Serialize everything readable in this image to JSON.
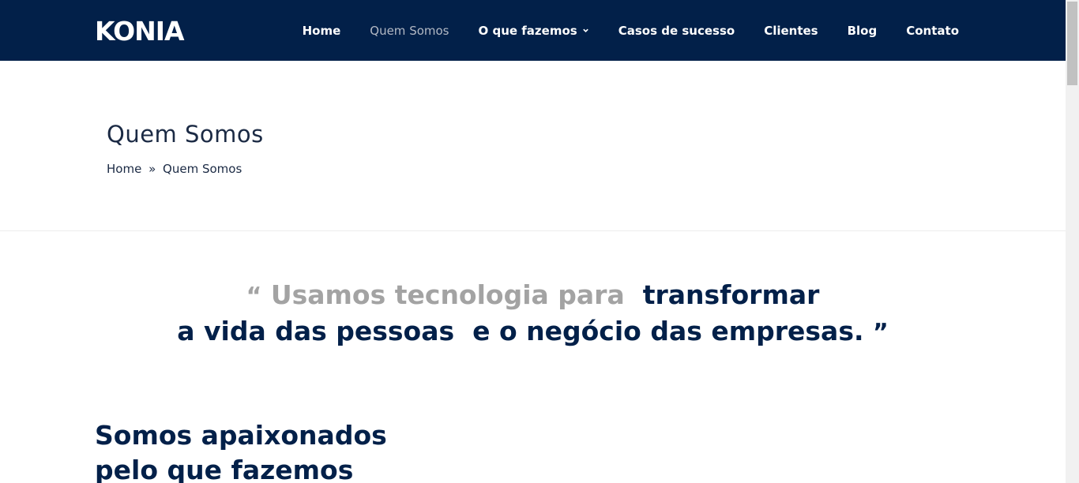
{
  "header": {
    "logo_text": "KONIA",
    "nav": [
      {
        "label": "Home",
        "active": false,
        "has_dropdown": false
      },
      {
        "label": "Quem Somos",
        "active": true,
        "has_dropdown": false
      },
      {
        "label": "O que fazemos",
        "active": false,
        "has_dropdown": true
      },
      {
        "label": "Casos de sucesso",
        "active": false,
        "has_dropdown": false
      },
      {
        "label": "Clientes",
        "active": false,
        "has_dropdown": false
      },
      {
        "label": "Blog",
        "active": false,
        "has_dropdown": false
      },
      {
        "label": "Contato",
        "active": false,
        "has_dropdown": false
      }
    ]
  },
  "title_area": {
    "title": "Quem Somos",
    "breadcrumb": {
      "home": "Home",
      "separator": "»",
      "current": "Quem Somos"
    }
  },
  "quote": {
    "open_mark": "“",
    "part1": "Usamos tecnologia para",
    "part2": "transformar",
    "part3": "a vida das pessoas",
    "part4": "e o negócio das empresas.",
    "close_mark": "”"
  },
  "section": {
    "heading_line1": "Somos apaixonados",
    "heading_line2": "pelo que fazemos"
  },
  "colors": {
    "header_bg": "#022049",
    "accent": "#022049",
    "muted_text": "#a3a3a3"
  }
}
